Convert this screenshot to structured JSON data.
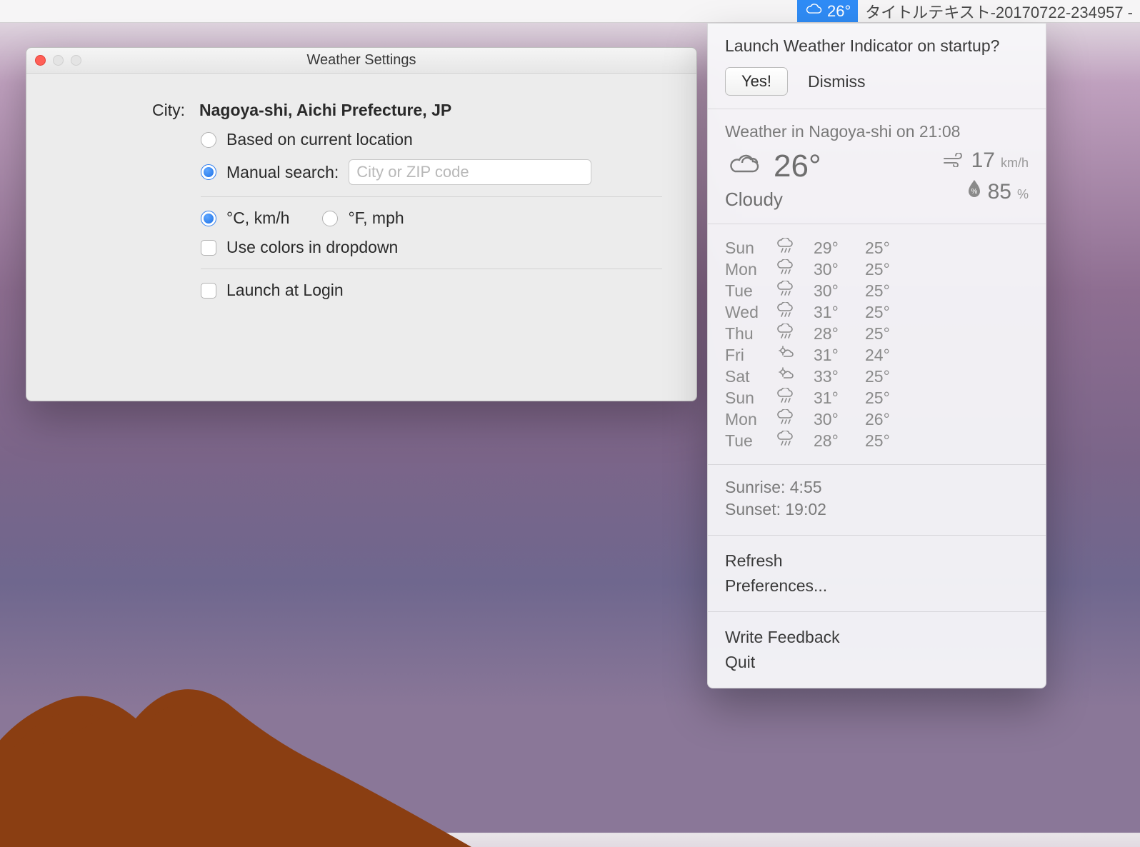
{
  "menubar": {
    "temp": "26°",
    "title_text": "タイトルテキスト-20170722-234957 -"
  },
  "settings": {
    "window_title": "Weather Settings",
    "city_label": "City:",
    "city_value": "Nagoya-shi, Aichi Prefecture, JP",
    "based_on_location": "Based on current location",
    "manual_search_label": "Manual search:",
    "manual_search_placeholder": "City or ZIP code",
    "units_metric": "°C, km/h",
    "units_imperial": "°F, mph",
    "use_colors": "Use colors in dropdown",
    "launch_at_login": "Launch at Login"
  },
  "panel": {
    "prompt_question": "Launch Weather Indicator on startup?",
    "yes_label": "Yes!",
    "dismiss_label": "Dismiss",
    "summary_heading": "Weather in Nagoya-shi on 21:08",
    "current_temp": "26°",
    "current_desc": "Cloudy",
    "wind_value": "17",
    "wind_unit": "km/h",
    "humidity_value": "85",
    "humidity_unit": "%",
    "forecast": [
      {
        "day": "Sun",
        "hi": "29°",
        "lo": "25°"
      },
      {
        "day": "Mon",
        "hi": "30°",
        "lo": "25°"
      },
      {
        "day": "Tue",
        "hi": "30°",
        "lo": "25°"
      },
      {
        "day": "Wed",
        "hi": "31°",
        "lo": "25°"
      },
      {
        "day": "Thu",
        "hi": "28°",
        "lo": "25°"
      },
      {
        "day": "Fri",
        "hi": "31°",
        "lo": "24°"
      },
      {
        "day": "Sat",
        "hi": "33°",
        "lo": "25°"
      },
      {
        "day": "Sun",
        "hi": "31°",
        "lo": "25°"
      },
      {
        "day": "Mon",
        "hi": "30°",
        "lo": "26°"
      },
      {
        "day": "Tue",
        "hi": "28°",
        "lo": "25°"
      }
    ],
    "sunrise": "Sunrise: 4:55",
    "sunset": "Sunset: 19:02",
    "refresh": "Refresh",
    "preferences": "Preferences...",
    "feedback": "Write Feedback",
    "quit": "Quit"
  }
}
